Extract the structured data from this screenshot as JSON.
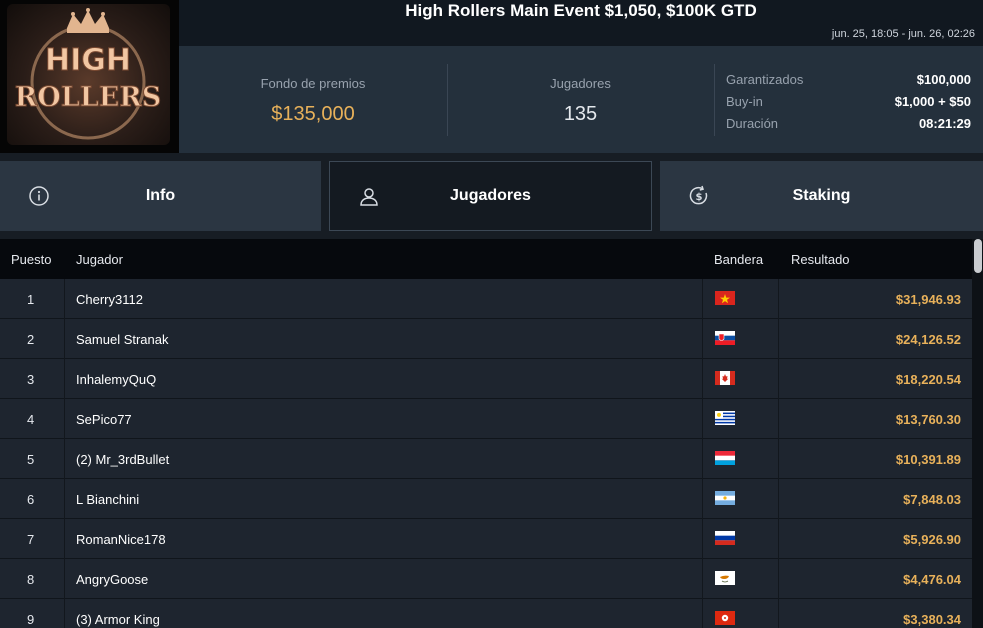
{
  "event": {
    "title": "High Rollers Main Event $1,050, $100K GTD",
    "date_range": "jun. 25, 18:05 - jun. 26, 02:26",
    "logo_text": "HIGH ROLLERS"
  },
  "stats": {
    "prize_pool_label": "Fondo de premios",
    "prize_pool_value": "$135,000",
    "players_label": "Jugadores",
    "players_value": "135"
  },
  "details": [
    {
      "label": "Garantizados",
      "value": "$100,000"
    },
    {
      "label": "Buy-in",
      "value": "$1,000 + $50"
    },
    {
      "label": "Duración",
      "value": "08:21:29"
    }
  ],
  "tabs": [
    {
      "label": "Info",
      "icon": "info-icon"
    },
    {
      "label": "Jugadores",
      "icon": "user-icon",
      "active": true
    },
    {
      "label": "Staking",
      "icon": "dollar-refresh-icon"
    }
  ],
  "table": {
    "headers": {
      "rank": "Puesto",
      "player": "Jugador",
      "flag": "Bandera",
      "result": "Resultado"
    },
    "rows": [
      {
        "rank": "1",
        "player": "Cherry3112",
        "flag": "vietnam-flag",
        "result": "$31,946.93"
      },
      {
        "rank": "2",
        "player": "Samuel Stranak",
        "flag": "slovakia-flag",
        "result": "$24,126.52"
      },
      {
        "rank": "3",
        "player": "InhalemyQuQ",
        "flag": "canada-flag",
        "result": "$18,220.54"
      },
      {
        "rank": "4",
        "player": "SePico77",
        "flag": "uruguay-flag",
        "result": "$13,760.30"
      },
      {
        "rank": "5",
        "player": "(2) Mr_3rdBullet",
        "flag": "luxembourg-flag",
        "result": "$10,391.89"
      },
      {
        "rank": "6",
        "player": "L Bianchini",
        "flag": "argentina-flag",
        "result": "$7,848.03"
      },
      {
        "rank": "7",
        "player": "RomanNice178",
        "flag": "russia-flag",
        "result": "$5,926.90"
      },
      {
        "rank": "8",
        "player": "AngryGoose",
        "flag": "cyprus-flag",
        "result": "$4,476.04"
      },
      {
        "rank": "9",
        "player": "(3) Armor King",
        "flag": "hong-kong-flag",
        "result": "$3,380.34"
      }
    ]
  },
  "colors": {
    "accent_gold": "#e8b15a",
    "background": "#1b222b"
  }
}
